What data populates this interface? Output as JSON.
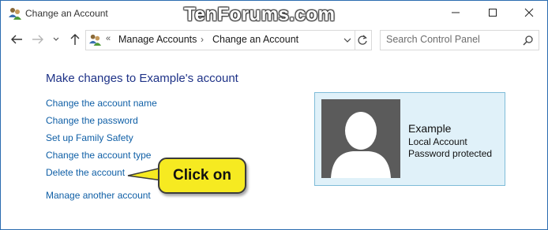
{
  "window": {
    "title": "Change an Account",
    "watermark": "TenForums.com"
  },
  "nav": {
    "address_prefix": "«",
    "breadcrumbs": [
      "Manage Accounts",
      "Change an Account"
    ],
    "breadcrumb_separator": "›",
    "search_placeholder": "Search Control Panel"
  },
  "content": {
    "heading": "Make changes to Example's account",
    "links": [
      "Change the account name",
      "Change the password",
      "Set up Family Safety",
      "Change the account type",
      "Delete the account"
    ],
    "manage_link": "Manage another account"
  },
  "account": {
    "name": "Example",
    "type": "Local Account",
    "password_status": "Password protected"
  },
  "callout": {
    "text": "Click on"
  },
  "colors": {
    "link": "#0f5fa6",
    "heading": "#1e3287",
    "card_bg": "#e0f1f9",
    "callout_bg": "#f6ea21"
  }
}
